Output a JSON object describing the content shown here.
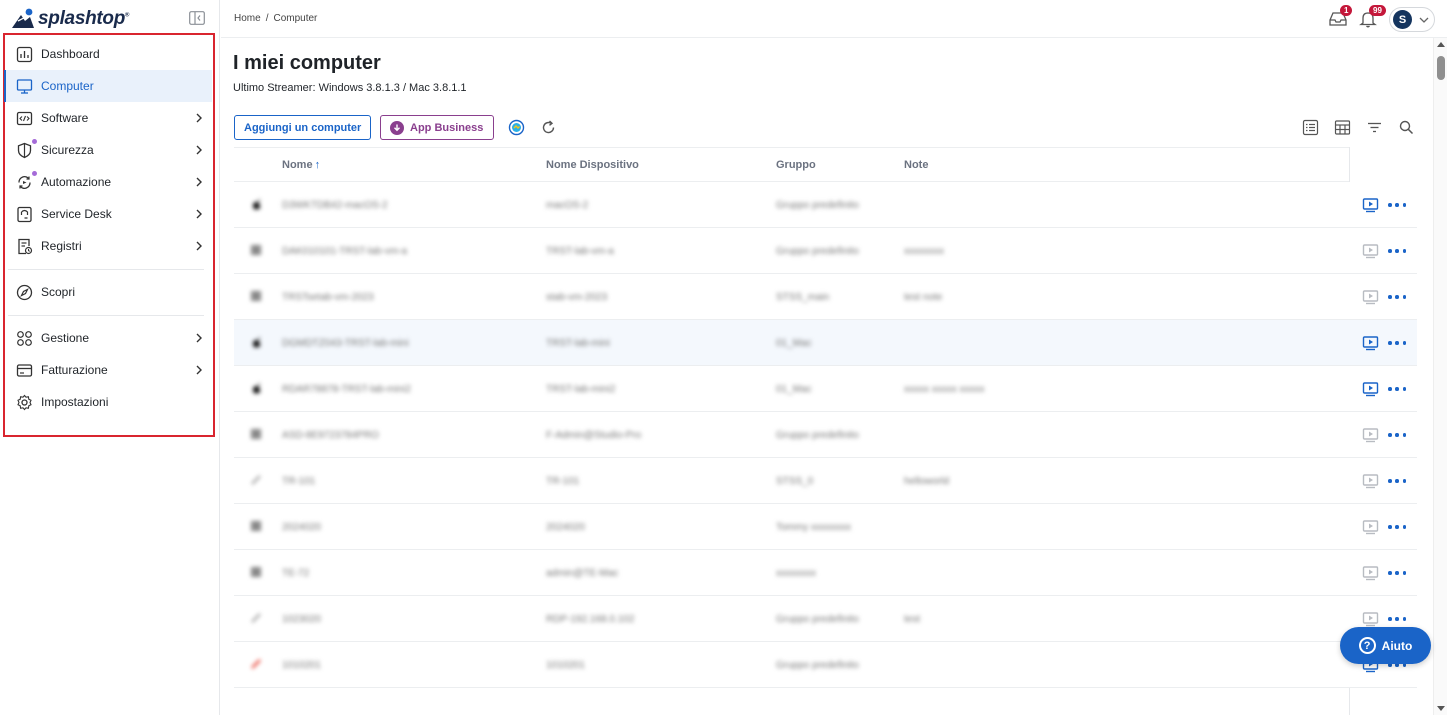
{
  "brand": {
    "name": "splashtop",
    "mark": "®"
  },
  "breadcrumb": {
    "home": "Home",
    "separator": "/",
    "current": "Computer"
  },
  "header": {
    "inbox_badge": "1",
    "notifications_badge": "99",
    "user_initial": "S"
  },
  "sidebar": {
    "items": [
      {
        "label": "Dashboard",
        "icon": "dashboard-icon",
        "active": false,
        "chevron": false
      },
      {
        "label": "Computer",
        "icon": "monitor-icon",
        "active": true,
        "chevron": false
      },
      {
        "label": "Software",
        "icon": "code-icon",
        "active": false,
        "chevron": true
      },
      {
        "label": "Sicurezza",
        "icon": "shield-icon",
        "active": false,
        "chevron": true,
        "dot": true
      },
      {
        "label": "Automazione",
        "icon": "automation-icon",
        "active": false,
        "chevron": true,
        "dot": true
      },
      {
        "label": "Service Desk",
        "icon": "service-desk-icon",
        "active": false,
        "chevron": true
      },
      {
        "label": "Registri",
        "icon": "logs-icon",
        "active": false,
        "chevron": true
      },
      {
        "label": "Scopri",
        "icon": "compass-icon",
        "active": false,
        "chevron": false
      },
      {
        "label": "Gestione",
        "icon": "management-icon",
        "active": false,
        "chevron": true
      },
      {
        "label": "Fatturazione",
        "icon": "billing-icon",
        "active": false,
        "chevron": true
      },
      {
        "label": "Impostazioni",
        "icon": "gear-icon",
        "active": false,
        "chevron": false
      }
    ]
  },
  "main": {
    "title": "I miei computer",
    "subtitle": "Ultimo Streamer: Windows 3.8.1.3 / Mac 3.8.1.1",
    "add_button": "Aggiungi un computer",
    "business_button": "App Business",
    "columns": {
      "name": "Nome",
      "name_sort": "↑",
      "device": "Nome Dispositivo",
      "group": "Gruppo",
      "notes": "Note"
    },
    "rows": [
      {
        "name": "D3WKTDB42-macOS-2",
        "device": "macOS-2",
        "group": "Gruppo predefinito",
        "notes": "",
        "os": "apple",
        "online": true
      },
      {
        "name": "DAK010101-TRST-lab-vm-a",
        "device": "TRST-lab-vm-a",
        "group": "Gruppo predefinito",
        "notes": "xxxxxxxx",
        "os": "windows",
        "online": false
      },
      {
        "name": "TRSTsetab-vm-2023",
        "device": "stab-vm-2023",
        "group": "STSS_main",
        "notes": "test note",
        "os": "windows",
        "online": false
      },
      {
        "name": "DGMDTZ043-TRST-lab-mini",
        "device": "TRST-lab-mini",
        "group": "01_Mac",
        "notes": "",
        "os": "apple",
        "online": true
      },
      {
        "name": "RDAR78878-TRST-lab-mini2",
        "device": "TRST-lab-mini2",
        "group": "01_Mac",
        "notes": "xxxxx xxxxx xxxxx",
        "os": "apple",
        "online": true
      },
      {
        "name": "ASD-8E9723784PRO",
        "device": "F-Admin@Studio-Pro",
        "group": "Gruppo predefinito",
        "notes": "",
        "os": "windows",
        "online": false
      },
      {
        "name": "TR-101",
        "device": "TR-101",
        "group": "STSS_0",
        "notes": "helloworld",
        "os": "linux",
        "online": false
      },
      {
        "name": "2024020",
        "device": "2024020",
        "group": "Tommy xxxxxxxx",
        "notes": "",
        "os": "windows",
        "online": false
      },
      {
        "name": "TE-72",
        "device": "admin@TE-Mac",
        "group": "xxxxxxxx",
        "notes": "",
        "os": "windows",
        "online": false
      },
      {
        "name": "1023020",
        "device": "RDP-192.168.0.102",
        "group": "Gruppo predefinito",
        "notes": "test",
        "os": "linux",
        "online": false
      },
      {
        "name": "1010201",
        "device": "1010201",
        "group": "Gruppo predefinito",
        "notes": "",
        "os": "android",
        "online": true
      }
    ]
  },
  "help": {
    "label": "Aiuto"
  },
  "colors": {
    "accent": "#1a64c8",
    "business": "#8a3f8e",
    "highlight_box": "#d9252f",
    "badge": "#c4173a"
  }
}
